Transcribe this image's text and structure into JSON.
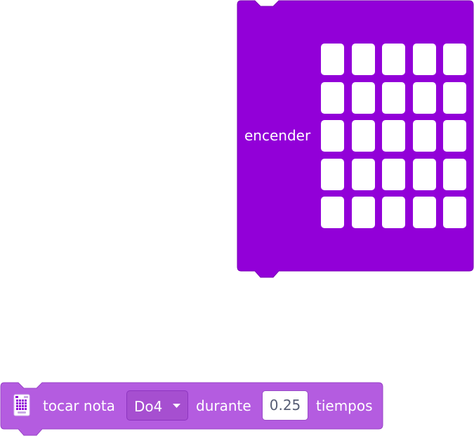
{
  "blocks": {
    "encender": {
      "label": "encender",
      "color": "#9200d8",
      "led_rows": 5,
      "led_cols": 5
    },
    "tocar_nota": {
      "label": "tocar nota",
      "note_value": "Do4",
      "durante_label": "durante",
      "beats_value": "0.25",
      "tiempos_label": "tiempos",
      "color": "#b45ce0",
      "icon": "microbit-extension-icon"
    }
  }
}
